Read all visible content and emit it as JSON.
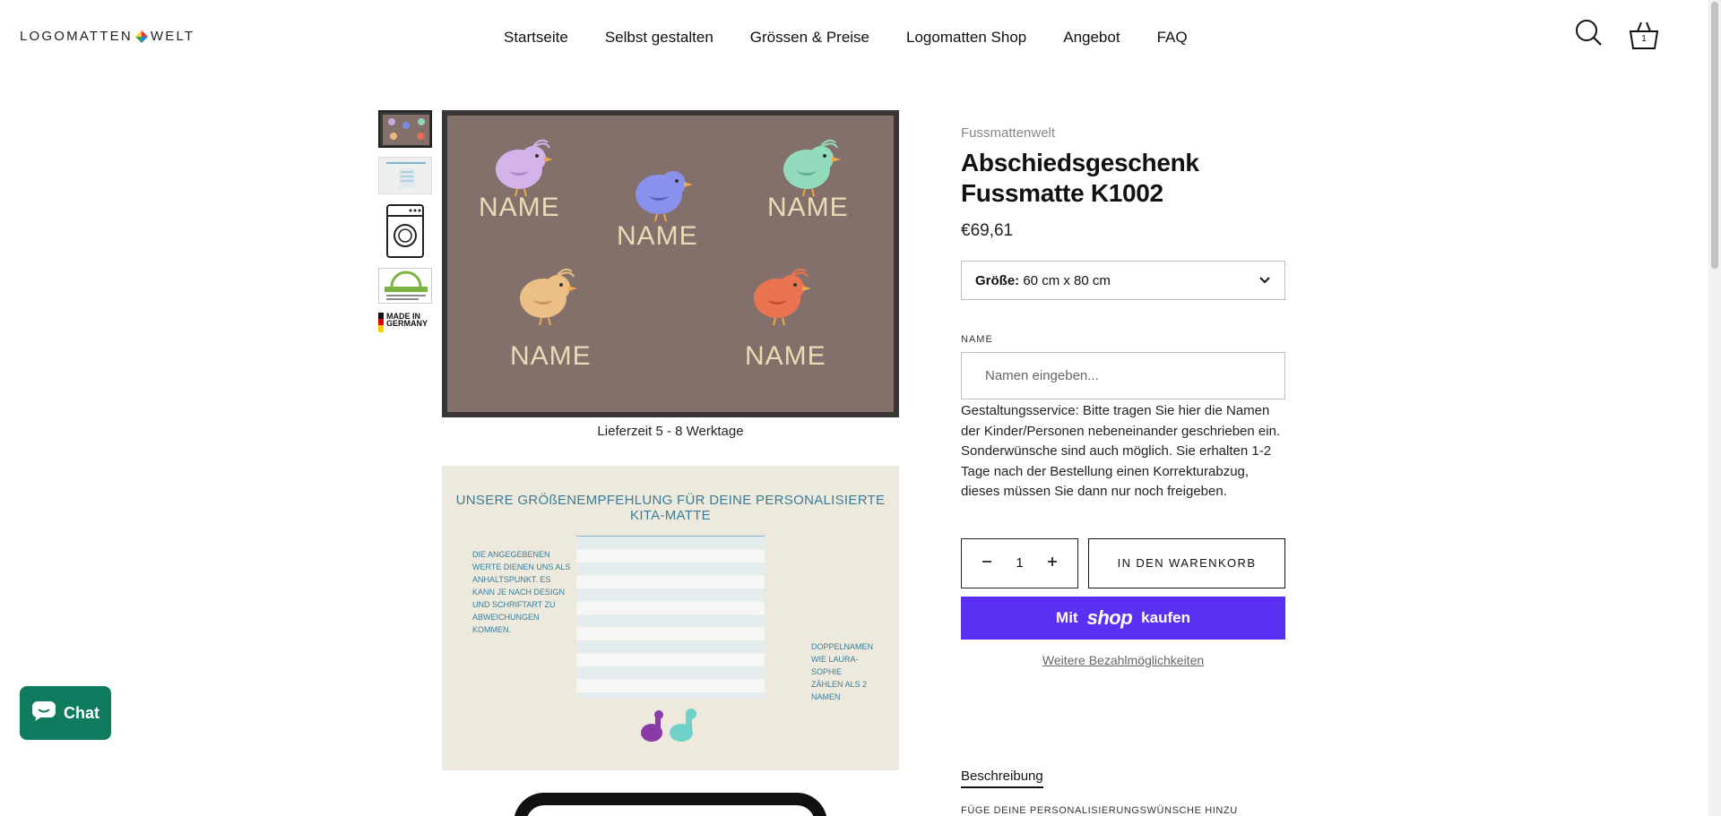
{
  "header": {
    "logo_left": "LOGOMATTEN",
    "logo_right": "WELT",
    "nav": [
      "Startseite",
      "Selbst gestalten",
      "Grössen & Preise",
      "Logomatten Shop",
      "Angebot",
      "FAQ"
    ],
    "cart_count": "1",
    "icons": [
      "search-icon",
      "basket-icon"
    ]
  },
  "gallery": {
    "thumb_made_in": "MADE IN GERMANY",
    "mat_names": [
      "NAME",
      "NAME",
      "NAME",
      "NAME",
      "NAME"
    ],
    "caption": "Lieferzeit 5 - 8 Werktage",
    "size_chart_title": "UNSERE GRÖßENEMPFEHLUNG FÜR DEINE PERSONALISIERTE KITA-MATTE",
    "size_chart_note": "DIE ANGEGEBENEN WERTE DIENEN UNS ALS ANHALTSPUNKT. ES KANN JE NACH DESIGN UND SCHRIFTART ZU ABWEICHUNGEN KOMMEN.",
    "size_chart_note2": "DOPPELNAMEN WIE LAURA-SOPHIE ZÄHLEN ALS 2 NAMEN"
  },
  "product": {
    "vendor": "Fussmattenwelt",
    "title_line1": "Abschiedsgeschenk",
    "title_line2": "Fussmatte K1002",
    "price": "€69,61",
    "size_label": "Größe:",
    "size_value": "60 cm x 80 cm",
    "name_label": "NAME",
    "name_placeholder": "Namen eingeben...",
    "help_text": "Gestaltungsservice: Bitte tragen Sie hier die Namen der Kinder/Personen nebeneinander geschrieben ein. Sonderwünsche sind auch möglich. Sie erhalten 1-2 Tage nach der Bestellung einen Korrekturabzug, dieses müssen Sie dann nur noch freigeben.",
    "quantity": "1",
    "add_to_cart": "IN DEN WARENKORB",
    "shop_pay_prefix": "Mit",
    "shop_pay_logo": "shop",
    "shop_pay_suffix": "kaufen",
    "more_payment": "Weitere Bezahlmöglichkeiten",
    "tab_description": "Beschreibung",
    "description_heading": "FÜGE DEINE PERSONALISIERUNGSWÜNSCHE HINZU"
  },
  "chat": {
    "label": "Chat"
  },
  "colors": {
    "shop_pay": "#5a31f4",
    "chat": "#0f7b5e",
    "mat": "#83706a",
    "mat_text": "#e8dcb6"
  }
}
